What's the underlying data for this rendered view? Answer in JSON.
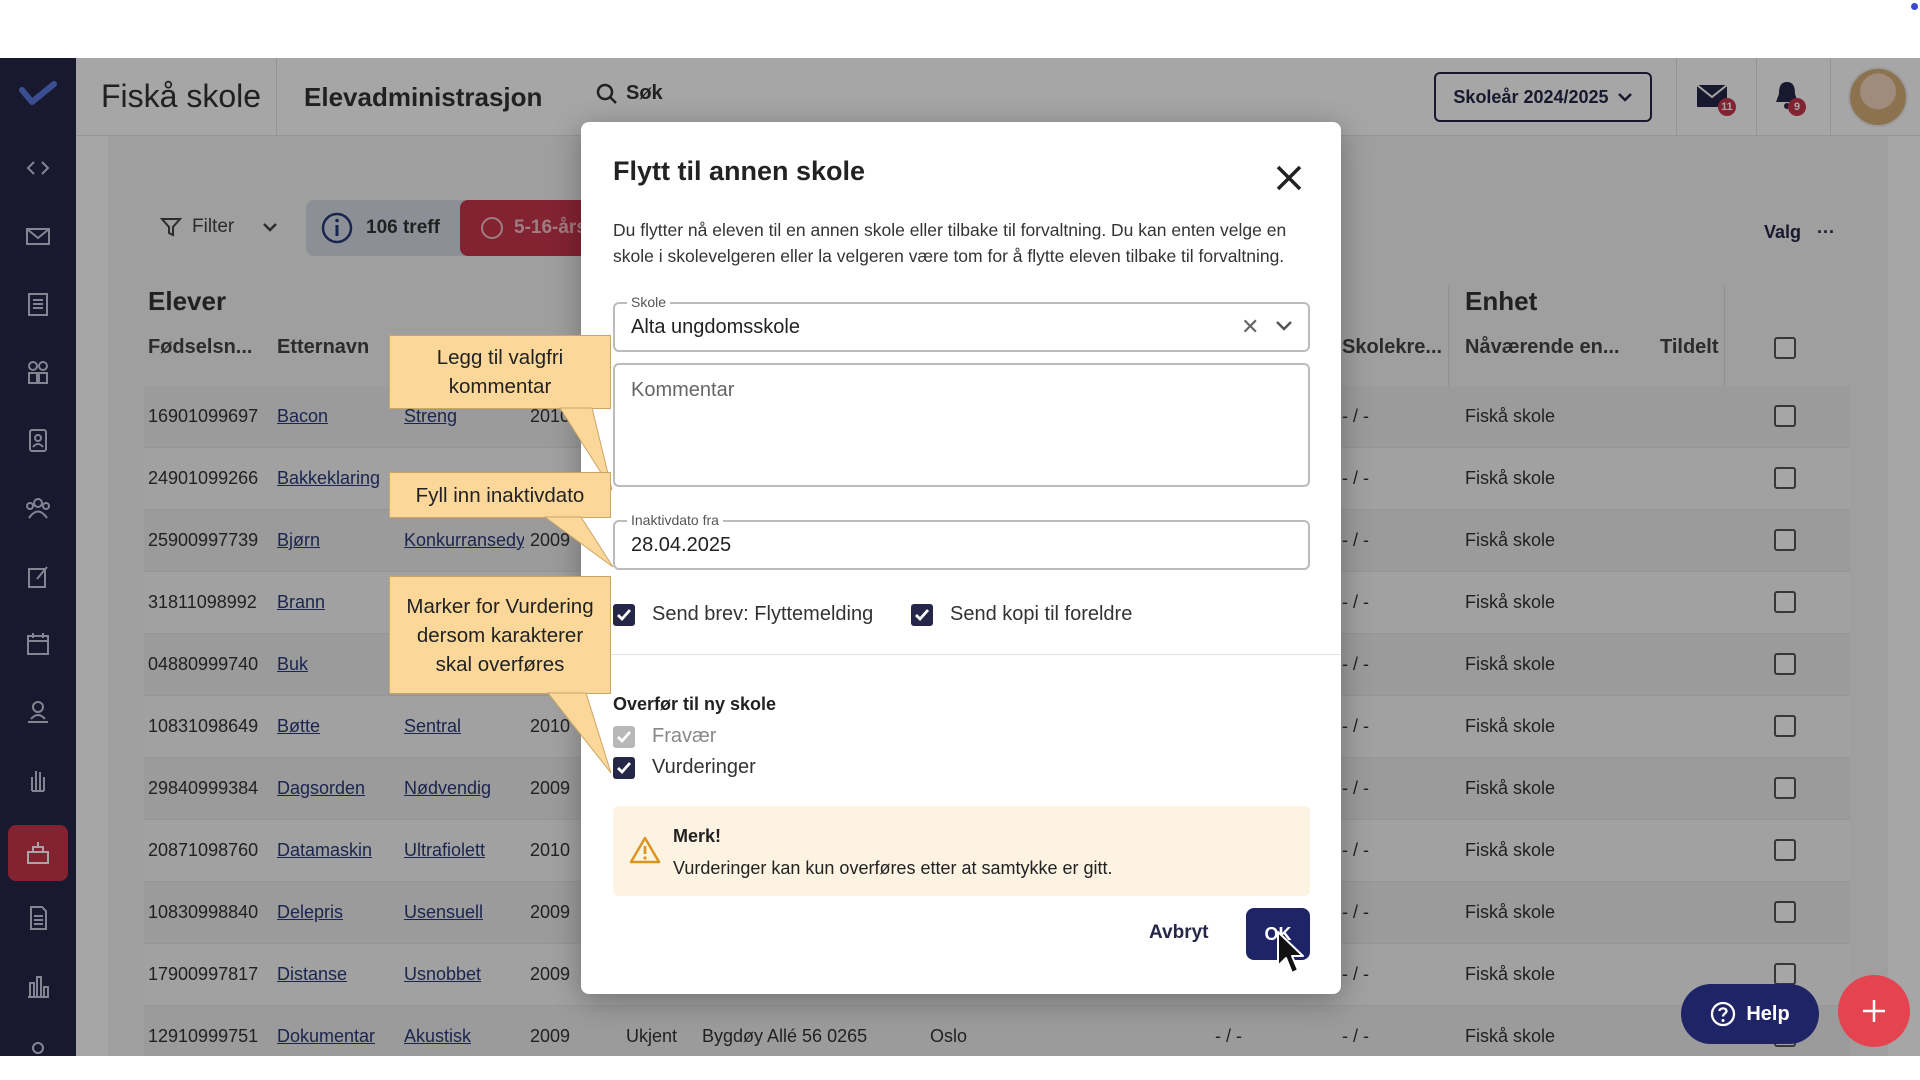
{
  "header": {
    "school_name": "Fiskå skole",
    "module_title": "Elevadministrasjon",
    "search_label": "Søk",
    "school_year": "Skoleår 2024/2025",
    "mail_count": "11",
    "notification_count": "9"
  },
  "toolbar": {
    "filter_label": "Filter",
    "result_count": "106 treff",
    "red_chip_label": "5-16-års",
    "valg_label": "Valg"
  },
  "table": {
    "section_students": "Elever",
    "section_unit": "Enhet",
    "columns": {
      "birth": "Fødselsn...",
      "lastname": "Etternavn",
      "skolekrets": "Skolekre...",
      "current_unit": "Nåværende en...",
      "assigned": "Tildelt"
    },
    "rows": [
      {
        "birth": "16901099697",
        "last": "Bacon",
        "first": "Streng",
        "year": "2010",
        "krets": "- / -",
        "unit": "Fiskå skole"
      },
      {
        "birth": "24901099266",
        "last": "Bakkeklaring",
        "first": "",
        "year": "",
        "krets": "- / -",
        "unit": "Fiskå skole"
      },
      {
        "birth": "25900997739",
        "last": "Bjørn",
        "first": "Konkurransedyl",
        "year": "2009",
        "krets": "- / -",
        "unit": "Fiskå skole"
      },
      {
        "birth": "31811098992",
        "last": "Brann",
        "first": "",
        "year": "",
        "krets": "- / -",
        "unit": "Fiskå skole"
      },
      {
        "birth": "04880999740",
        "last": "Buk",
        "first": "",
        "year": "",
        "krets": "- / -",
        "unit": "Fiskå skole"
      },
      {
        "birth": "10831098649",
        "last": "Bøtte",
        "first": "Sentral",
        "year": "2010",
        "krets": "- / -",
        "unit": "Fiskå skole"
      },
      {
        "birth": "29840999384",
        "last": "Dagsorden",
        "first": "Nødvendig",
        "year": "2009",
        "krets": "- / -",
        "unit": "Fiskå skole"
      },
      {
        "birth": "20871098760",
        "last": "Datamaskin",
        "first": "Ultrafiolett",
        "year": "2010",
        "krets": "- / -",
        "unit": "Fiskå skole"
      },
      {
        "birth": "10830998840",
        "last": "Delepris",
        "first": "Usensuell",
        "year": "2009",
        "krets": "- / -",
        "unit": "Fiskå skole"
      },
      {
        "birth": "17900997817",
        "last": "Distanse",
        "first": "Usnobbet",
        "year": "2009",
        "krets": "- / -",
        "unit": "Fiskå skole"
      },
      {
        "birth": "12910999751",
        "last": "Dokumentar",
        "first": "Akustisk",
        "year": "2009",
        "status": "Ukjent",
        "address": "Bygdøy Allé 56 0265",
        "city": "Oslo",
        "extra": "- / -",
        "krets": "- / -",
        "unit": "Fiskå skole"
      }
    ]
  },
  "modal": {
    "title": "Flytt til annen skole",
    "description": "Du flytter nå eleven til en annen skole eller tilbake til forvaltning. Du kan enten velge en skole i skolevelgeren eller la velgeren være tom for å flytte eleven tilbake til forvaltning.",
    "school_field_label": "Skole",
    "school_field_value": "Alta ungdomsskole",
    "comment_placeholder": "Kommentar",
    "inactive_date_label": "Inaktivdato fra",
    "inactive_date_value": "28.04.2025",
    "send_letter_label": "Send brev: Flyttemelding",
    "send_copy_label": "Send kopi til foreldre",
    "transfer_section": "Overfør til ny skole",
    "absence_label": "Fravær",
    "assessments_label": "Vurderinger",
    "alert_title": "Merk!",
    "alert_text": "Vurderinger kan kun overføres etter at samtykke er gitt.",
    "cancel_label": "Avbryt",
    "ok_label": "OK"
  },
  "callouts": {
    "comment": "Legg til valgfri kommentar",
    "date": "Fyll inn inaktivdato",
    "assessments": "Marker for Vurdering dersom karakterer skal overføres"
  },
  "help_label": "Help",
  "colors": {
    "navy": "#262748",
    "accent_red": "#c9364d",
    "callout": "#fbd89a",
    "alert_bg": "#fdf3e3"
  }
}
